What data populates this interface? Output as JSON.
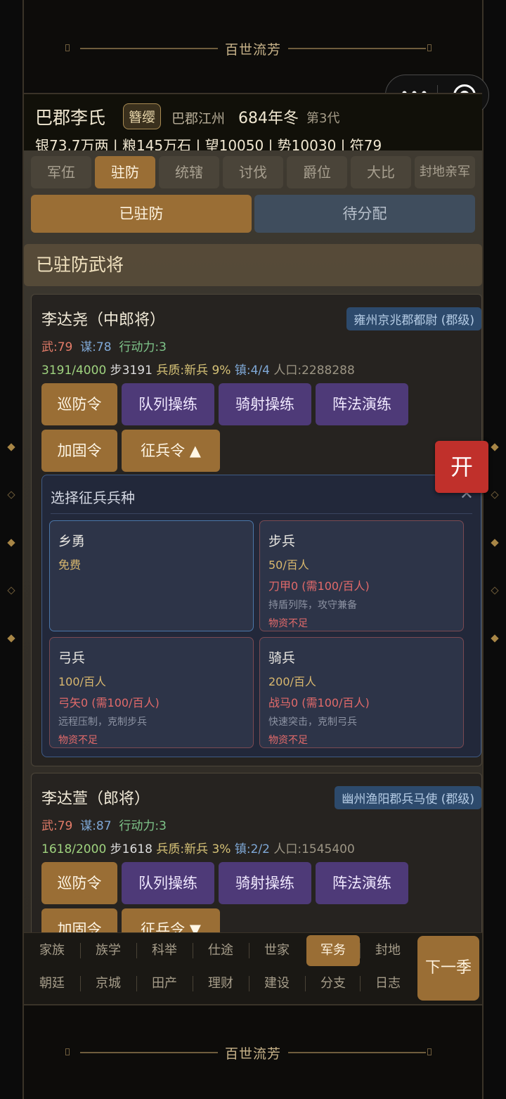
{
  "banner": {
    "top_title": "百世流芳",
    "bottom_title": "百世流芳"
  },
  "header": {
    "clan": "巴郡李氏",
    "age_badge": "簪缨",
    "location": "巴郡江州",
    "year": "684年冬",
    "generation": "第3代",
    "resources": "银73.7万两 | 粮145万石 | 望10050 | 势10030 | 符79"
  },
  "tabs": [
    "军伍",
    "驻防",
    "统辖",
    "讨伐",
    "爵位",
    "大比",
    "封地亲军"
  ],
  "segments": {
    "stationed": "已驻防",
    "pending": "待分配"
  },
  "section_title": "已驻防武将",
  "generals": [
    {
      "name": "李达尧（中郎将）",
      "post": "雍州京兆郡都尉 (郡级)",
      "wu": "武:79",
      "mou": "谋:78",
      "action": "行动力:3",
      "troops": "3191/4000",
      "infantry": "步3191",
      "quality": "兵质:新兵 9%",
      "towns": "镇:4/4",
      "population": "人口:2288288",
      "buttons": [
        "巡防令",
        "队列操练",
        "骑射操练",
        "阵法演练",
        "加固令",
        "征兵令 ▲"
      ]
    },
    {
      "name": "李达萱（郎将）",
      "post": "幽州渔阳郡兵马使 (郡级)",
      "wu": "武:79",
      "mou": "谋:87",
      "action": "行动力:3",
      "troops": "1618/2000",
      "infantry": "步1618",
      "quality": "兵质:新兵 3%",
      "towns": "镇:2/2",
      "population": "人口:1545400",
      "buttons": [
        "巡防令",
        "队列操练",
        "骑射操练",
        "阵法演练",
        "加固令",
        "征兵令 ▼"
      ]
    }
  ],
  "recruit_picker": {
    "title": "选择征兵兵种",
    "close_glyph": "✕",
    "options": [
      {
        "name": "乡勇",
        "cost": "免费"
      },
      {
        "name": "步兵",
        "cost": "50/百人",
        "need": "刀甲0 (需100/百人)",
        "desc": "持盾列阵，攻守兼备",
        "warn": "物资不足"
      },
      {
        "name": "弓兵",
        "cost": "100/百人",
        "need": "弓矢0 (需100/百人)",
        "desc": "远程压制，克制步兵",
        "warn": "物资不足"
      },
      {
        "name": "骑兵",
        "cost": "200/百人",
        "need": "战马0 (需100/百人)",
        "desc": "快速突击，克制弓兵",
        "warn": "物资不足"
      }
    ]
  },
  "kai_button": "开",
  "bottom_nav": {
    "row1": [
      "家族",
      "族学",
      "科举",
      "仕途",
      "世家",
      "军务",
      "封地"
    ],
    "row2": [
      "朝廷",
      "京城",
      "田产",
      "理财",
      "建设",
      "分支",
      "日志"
    ],
    "active": "军务",
    "next_season": "下一季"
  },
  "colors": {
    "accent_brown": "#9a6e35",
    "purple_button": "#4e3a78",
    "post_badge": "#2d4a6c",
    "kai_red": "#c0302b"
  }
}
